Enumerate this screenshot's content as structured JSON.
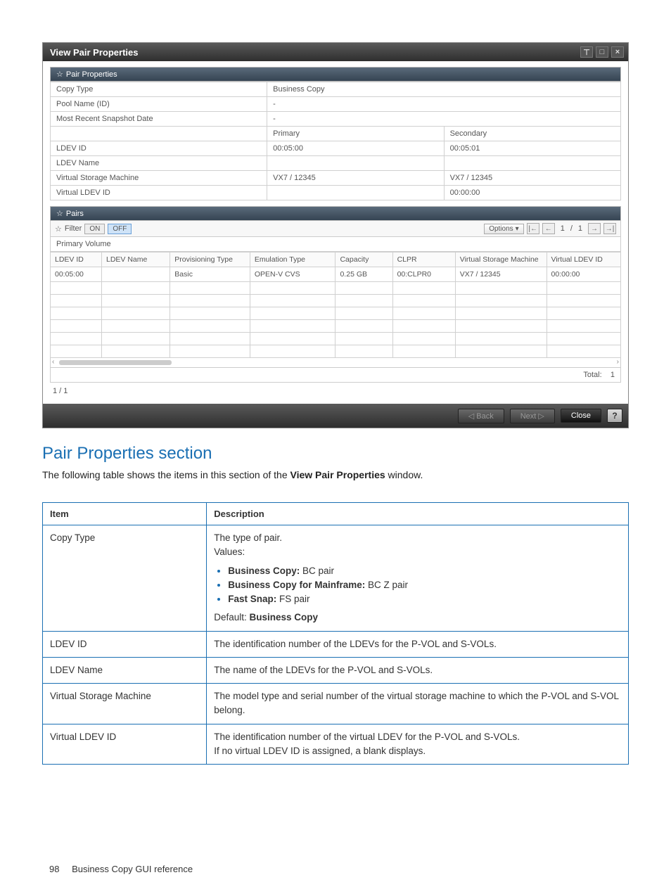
{
  "window": {
    "title": "View Pair Properties",
    "sections": {
      "pair_properties": {
        "header": "Pair Properties",
        "marker": "☆",
        "rows": {
          "copy_type_label": "Copy Type",
          "copy_type_value": "Business Copy",
          "pool_name_label": "Pool Name (ID)",
          "pool_name_value": "-",
          "snapshot_label": "Most Recent Snapshot Date",
          "snapshot_value": "-",
          "primary_header": "Primary",
          "secondary_header": "Secondary",
          "ldev_id_label": "LDEV ID",
          "ldev_id_primary": "00:05:00",
          "ldev_id_secondary": "00:05:01",
          "ldev_name_label": "LDEV Name",
          "ldev_name_primary": "",
          "ldev_name_secondary": "",
          "vsm_label": "Virtual Storage Machine",
          "vsm_primary": "VX7 / 12345",
          "vsm_secondary": "VX7 / 12345",
          "vldev_label": "Virtual LDEV ID",
          "vldev_primary": "",
          "vldev_secondary": "00:00:00"
        }
      },
      "pairs": {
        "header": "Pairs",
        "marker": "☆",
        "filter_label": "Filter",
        "filter_marker": "☆",
        "filter_on": "ON",
        "filter_off": "OFF",
        "options_label": "Options",
        "page_current": "1",
        "page_sep": "/",
        "page_total": "1",
        "sub_header": "Primary Volume",
        "columns": {
          "ldev_id": "LDEV ID",
          "ldev_name": "LDEV Name",
          "prov_type": "Provisioning Type",
          "emu_type": "Emulation Type",
          "capacity": "Capacity",
          "clpr": "CLPR",
          "vsm": "Virtual Storage Machine",
          "vldev": "Virtual LDEV ID"
        },
        "row1": {
          "ldev_id": "00:05:00",
          "ldev_name": "",
          "prov_type": "Basic",
          "emu_type": "OPEN-V CVS",
          "capacity": "0.25 GB",
          "clpr": "00:CLPR0",
          "vsm": "VX7 / 12345",
          "vldev": "00:00:00"
        },
        "total_label": "Total:",
        "total_value": "1",
        "pager_under": "1 / 1"
      }
    },
    "buttons": {
      "back": "◁ Back",
      "next": "Next ▷",
      "close": "Close",
      "help": "?"
    }
  },
  "doc": {
    "heading": "Pair Properties section",
    "intro": "The following table shows the items in this section of the ",
    "intro_bold": "View Pair Properties",
    "intro_tail": " window.",
    "headers": {
      "item": "Item",
      "desc": "Description"
    },
    "rows": {
      "r1": {
        "item": "Copy Type",
        "d1": "The type of pair.",
        "d2": "Values:",
        "b1a": "Business Copy:",
        "b1b": " BC pair",
        "b2a": "Business Copy for Mainframe:",
        "b2b": " BC Z pair",
        "b3a": "Fast Snap:",
        "b3b": " FS pair",
        "d3a": "Default: ",
        "d3b": "Business Copy"
      },
      "r2": {
        "item": "LDEV ID",
        "desc": "The identification number of the LDEVs for the P-VOL and S-VOLs."
      },
      "r3": {
        "item": "LDEV Name",
        "desc": "The name of the LDEVs for the P-VOL and S-VOLs."
      },
      "r4": {
        "item": "Virtual Storage Machine",
        "desc": "The model type and serial number of the virtual storage machine to which the P-VOL and S-VOL belong."
      },
      "r5": {
        "item": "Virtual LDEV ID",
        "d1": "The identification number of the virtual LDEV for the P-VOL and S-VOLs.",
        "d2": "If no virtual LDEV ID is assigned, a blank displays."
      }
    }
  },
  "footer": {
    "page_no": "98",
    "text": "Business Copy GUI reference"
  }
}
